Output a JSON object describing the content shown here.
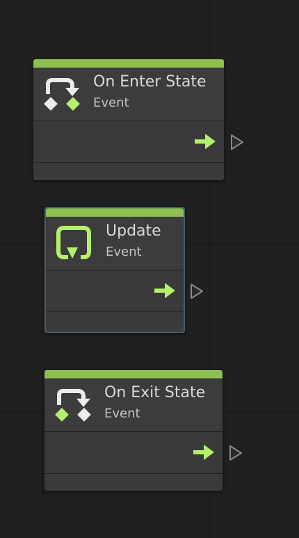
{
  "nodes": [
    {
      "id": "on-enter-state",
      "title": "On Enter State",
      "subtitle": "Event",
      "icon": "enter-state-icon",
      "selected": false
    },
    {
      "id": "update",
      "title": "Update",
      "subtitle": "Event",
      "icon": "update-loop-icon",
      "selected": true
    },
    {
      "id": "on-exit-state",
      "title": "On Exit State",
      "subtitle": "Event",
      "icon": "exit-state-icon",
      "selected": false
    }
  ],
  "colors": {
    "canvas": "#202020",
    "node_body": "#3c3c3c",
    "header_accent": "#8cc04f",
    "flow_arrow": "#b4f06a",
    "selection_outline": "#44606e",
    "port_outline": "#8a8a8a"
  }
}
